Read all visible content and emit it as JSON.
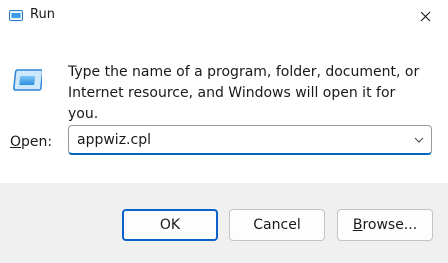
{
  "window": {
    "title": "Run",
    "icon": "run-icon",
    "close_icon": "close-icon"
  },
  "main": {
    "description": "Type the name of a program, folder, document, or Internet resource, and Windows will open it for you.",
    "open_label_key": "O",
    "open_label_rest": "pen:",
    "open_value": "appwiz.cpl",
    "dropdown_icon": "chevron-down-icon"
  },
  "buttons": {
    "ok": "OK",
    "cancel": "Cancel",
    "browse_key": "B",
    "browse_rest": "rowse..."
  },
  "colors": {
    "accent": "#0067c0",
    "footer_bg": "#f0f0f0"
  }
}
